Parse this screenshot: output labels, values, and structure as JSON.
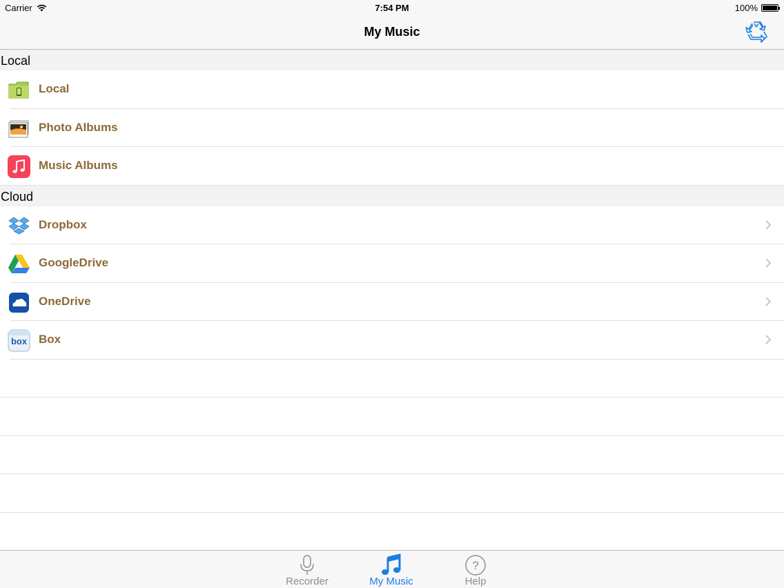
{
  "status_bar": {
    "carrier": "Carrier",
    "time": "7:54 PM",
    "battery": "100%"
  },
  "nav": {
    "title": "My Music"
  },
  "sections": [
    {
      "header": "Local",
      "items": [
        {
          "label": "Local",
          "icon": "folder-icon"
        },
        {
          "label": "Photo Albums",
          "icon": "photo-albums-icon"
        },
        {
          "label": "Music Albums",
          "icon": "music-albums-icon"
        }
      ]
    },
    {
      "header": "Cloud",
      "items": [
        {
          "label": "Dropbox",
          "icon": "dropbox-icon"
        },
        {
          "label": "GoogleDrive",
          "icon": "google-drive-icon"
        },
        {
          "label": "OneDrive",
          "icon": "onedrive-icon"
        },
        {
          "label": "Box",
          "icon": "box-icon"
        }
      ]
    }
  ],
  "tabs": [
    {
      "label": "Recorder",
      "icon": "microphone-icon",
      "active": false
    },
    {
      "label": "My Music",
      "icon": "music-note-icon",
      "active": true
    },
    {
      "label": "Help",
      "icon": "help-icon",
      "active": false
    }
  ],
  "colors": {
    "accent": "#1a7fe0",
    "row_label": "#8c6a37",
    "section_bg": "#f2f2f2"
  }
}
